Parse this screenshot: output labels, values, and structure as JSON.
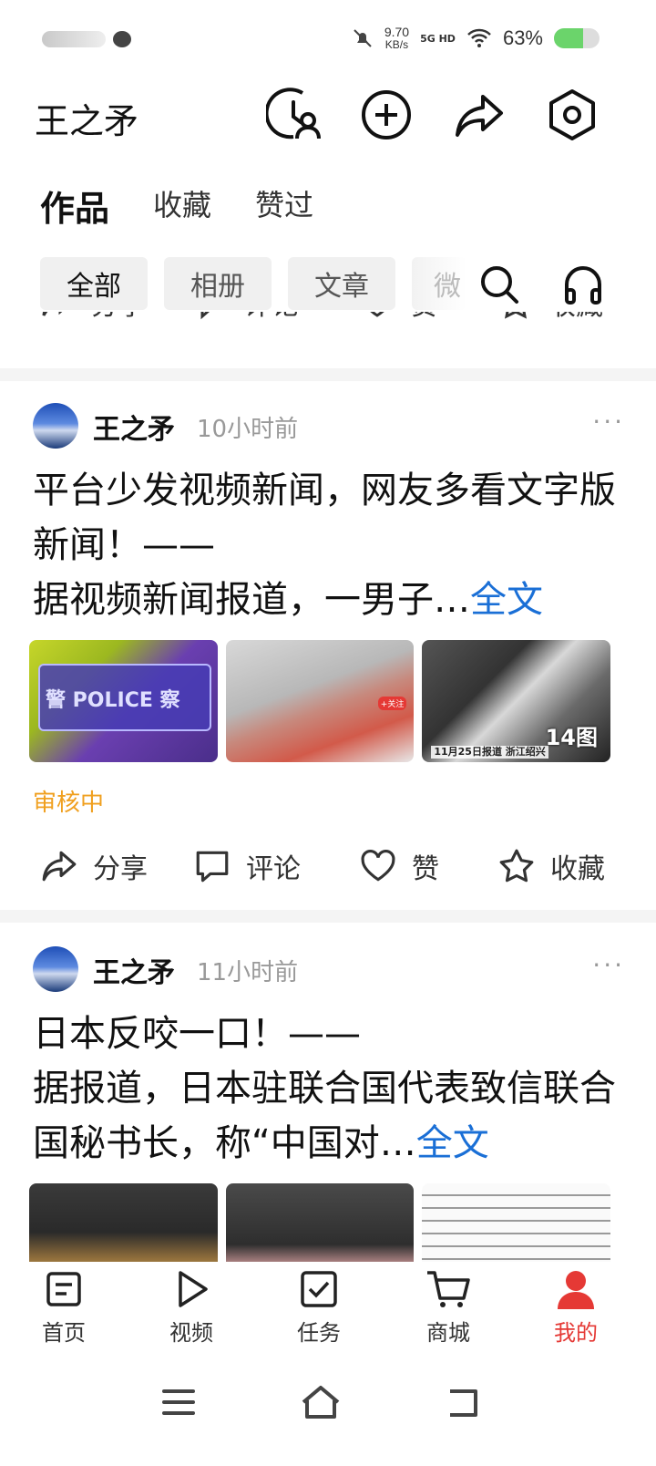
{
  "status_bar": {
    "speed_value": "9.70",
    "speed_unit": "KB/s",
    "network": "5G HD",
    "battery_text": "63%",
    "battery_level": 0.63,
    "battery_color": "#6bd46b"
  },
  "header": {
    "name": "王之矛",
    "icons": [
      "history-user-icon",
      "plus-circle-icon",
      "share-icon",
      "settings-hex-icon"
    ]
  },
  "tabs": [
    {
      "label": "作品",
      "active": true
    },
    {
      "label": "收藏",
      "active": false
    },
    {
      "label": "赞过",
      "active": false
    }
  ],
  "filters": [
    {
      "label": "全部",
      "active": true
    },
    {
      "label": "相册",
      "active": false
    },
    {
      "label": "文章",
      "active": false
    },
    {
      "label": "微",
      "active": false
    }
  ],
  "actions": {
    "share": "分享",
    "comment": "评论",
    "like": "赞",
    "collect": "收藏"
  },
  "posts": [
    {
      "author": "王之矛",
      "time": "10小时前",
      "more": "···",
      "text": "平台少发视频新闻，网友多看文字版新闻！——\n据视频新闻报道，一男子…",
      "full_link": "全文",
      "thumbs": [
        {
          "label": "警 POLICE 察"
        },
        {
          "label": "+关注"
        },
        {
          "label": "11月25日报道 浙江绍兴",
          "count": "14图"
        }
      ],
      "status": "审核中"
    },
    {
      "author": "王之矛",
      "time": "11小时前",
      "more": "···",
      "text": "日本反咬一口！——\n据报道，日本驻联合国代表致信联合国秘书长，称“中国对…",
      "full_link": "全文"
    }
  ],
  "bottom_nav": [
    {
      "label": "首页",
      "icon": "home-doc-icon",
      "active": false
    },
    {
      "label": "视频",
      "icon": "play-icon",
      "active": false
    },
    {
      "label": "任务",
      "icon": "task-check-icon",
      "active": false
    },
    {
      "label": "商城",
      "icon": "cart-icon",
      "active": false
    },
    {
      "label": "我的",
      "icon": "person-icon",
      "active": true
    }
  ],
  "accent_color": "#e53935",
  "link_color": "#1a6fd6",
  "review_color": "#f0a020"
}
